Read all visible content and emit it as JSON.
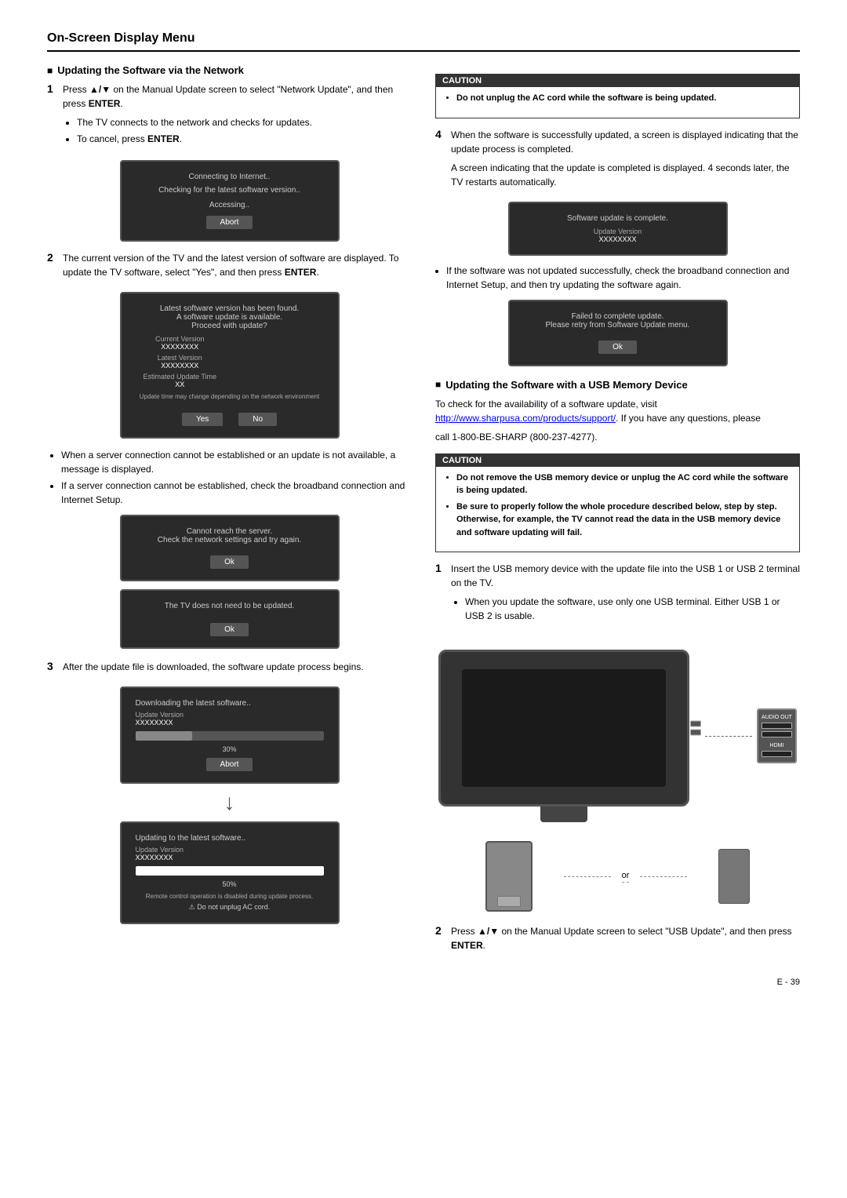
{
  "page": {
    "title": "On-Screen Display Menu",
    "footer": "E - 39"
  },
  "left_col": {
    "section1": {
      "title": "Updating the Software via the Network",
      "step1": {
        "number": "1",
        "text1": "Press ",
        "arrows": "▲/▼",
        "text2": " on the Manual Update screen to select \"Network Update\", and then press ",
        "enter": "ENTER",
        "text3": ".",
        "bullets": [
          "The TV connects to the network and checks for updates.",
          "To cancel, press ENTER."
        ]
      },
      "screen1": {
        "lines": [
          "Connecting to Internet..",
          "Checking for the latest software version.."
        ],
        "line2": "Accessing..",
        "button": "Abort"
      },
      "step2": {
        "number": "2",
        "text": "The current version of the TV and the latest version of software are displayed. To update the TV software, select \"Yes\", and then press ENTER."
      },
      "screen2": {
        "line1": "Latest software version has been found.",
        "line2": "A software update is available.",
        "line3": "Proceed with update?",
        "current_label": "Current Version",
        "current_val": "XXXXXXXX",
        "latest_label": "Latest Version",
        "latest_val": "XXXXXXXX",
        "estimated_label": "Estimated Update Time",
        "estimated_val": "XX",
        "note": "Update time may change depending on the network environment",
        "btn_yes": "Yes",
        "btn_no": "No"
      },
      "server_note": {
        "bullet1": "When a server connection cannot be established or an update is not available, a message is displayed.",
        "bullet2": "If a server connection cannot be established, check the broadband connection and Internet Setup."
      },
      "screen3": {
        "line1": "Cannot reach the server.",
        "line2": "Check the network settings and try again.",
        "button": "Ok"
      },
      "screen4": {
        "line1": "The TV does not need to be updated.",
        "button": "Ok"
      },
      "step3": {
        "number": "3",
        "text": "After the update file is downloaded, the software update process begins."
      },
      "screen5": {
        "title": "Downloading the latest software..",
        "update_label": "Update Version",
        "update_val": "XXXXXXXX",
        "progress_pct": "30%",
        "button": "Abort"
      },
      "screen6": {
        "title": "Updating to the latest software..",
        "update_label": "Update Version",
        "update_val": "XXXXXXXX",
        "progress_pct": "50%",
        "note": "Remote control operation is disabled during update process.",
        "warning": "⚠ Do not unplug AC cord."
      }
    }
  },
  "right_col": {
    "caution1": {
      "header": "CAUTION",
      "bullets": [
        "Do not unplug the AC cord while the software is being updated."
      ]
    },
    "step4": {
      "number": "4",
      "text1": "When the software is successfully updated, a screen is displayed indicating that the update process is completed.",
      "text2": "A screen indicating that the update is completed is displayed. 4 seconds later, the TV restarts automatically."
    },
    "screen_complete": {
      "line1": "Software update is complete.",
      "update_label": "Update Version",
      "update_val": "XXXXXXXX"
    },
    "not_updated_note": "If the software was not updated successfully, check the broadband connection and Internet Setup, and then try updating the software again.",
    "screen_failed": {
      "line1": "Failed to complete update.",
      "line2": "Please retry from Software Update menu.",
      "button": "Ok"
    },
    "section2": {
      "title": "Updating the Software with a USB Memory Device",
      "text1": "To check for the availability of a software update, visit http://www.sharpusa.com/products/support/. If you have any questions, please",
      "text2": "call 1-800-BE-SHARP (800-237-4277)."
    },
    "caution2": {
      "header": "CAUTION",
      "bullets": [
        "Do not remove the USB memory device or unplug the AC cord while the software is being updated.",
        "Be sure to properly follow the whole procedure described below, step by step. Otherwise, for example, the TV cannot read the data in the USB memory device and software updating will fail."
      ]
    },
    "step1_usb": {
      "number": "1",
      "text": "Insert the USB memory device with the update file into the USB 1 or USB 2 terminal on the TV.",
      "bullet": "When you update the software, use only one USB terminal. Either USB 1 or USB 2 is usable."
    },
    "illustration": {
      "or_text": "or"
    },
    "step2_usb": {
      "number": "2",
      "text1": "Press ",
      "arrows": "▲/▼",
      "text2": " on the Manual Update screen to select \"USB Update\", and then press ",
      "enter": "ENTER",
      "text3": "."
    }
  }
}
